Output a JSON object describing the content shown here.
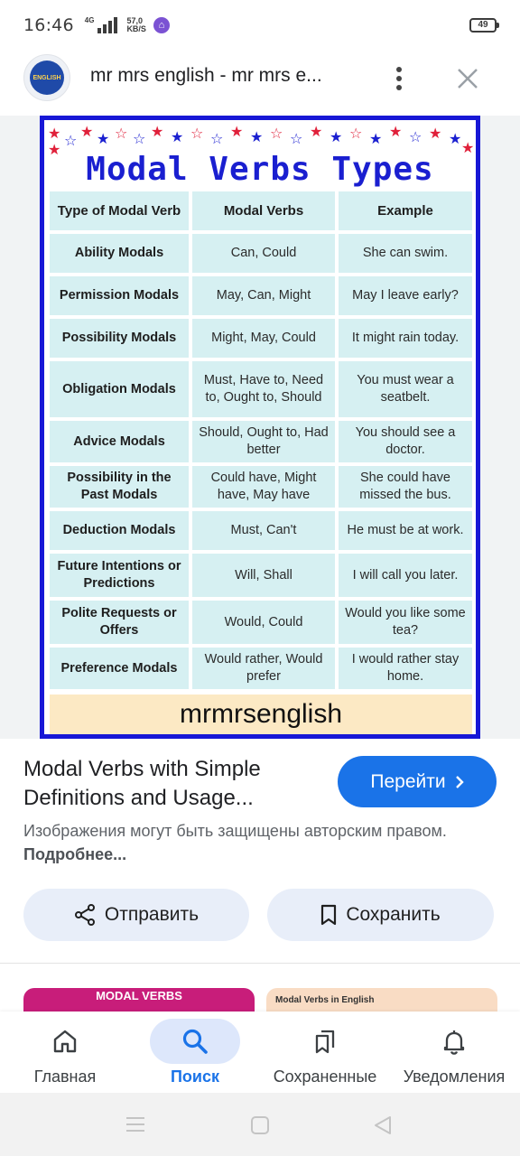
{
  "status_bar": {
    "time": "16:46",
    "network": "4G",
    "speed_value": "57,0",
    "speed_unit": "KB/S",
    "battery": "49"
  },
  "header": {
    "avatar_text": "ENGLISH",
    "title": "mr mrs english - mr mrs e..."
  },
  "infographic": {
    "title": "Modal Verbs Types",
    "headers": [
      "Type of Modal Verb",
      "Modal Verbs",
      "Example"
    ],
    "rows": [
      [
        "Ability Modals",
        "Can, Could",
        "She can swim."
      ],
      [
        "Permission Modals",
        "May, Can, Might",
        "May I leave early?"
      ],
      [
        "Possibility Modals",
        "Might, May, Could",
        "It might rain today."
      ],
      [
        "Obligation Modals",
        "Must, Have to, Need to, Ought to, Should",
        "You must wear a seatbelt."
      ],
      [
        "Advice Modals",
        "Should, Ought to, Had better",
        "You should see a doctor."
      ],
      [
        "Possibility in the Past Modals",
        "Could have, Might have, May have",
        "She could have missed the bus."
      ],
      [
        "Deduction Modals",
        "Must, Can't",
        "He must be at work."
      ],
      [
        "Future Intentions or Predictions",
        "Will, Shall",
        "I will call you later."
      ],
      [
        "Polite Requests or Offers",
        "Would, Could",
        "Would you like some tea?"
      ],
      [
        "Preference Modals",
        "Would rather, Would prefer",
        "I would rather stay home."
      ]
    ],
    "brand": "mrmrsenglish",
    "colors": {
      "border": "#1717d6",
      "title": "#1a1fd0",
      "cell": "#d6f0f2",
      "brand_bg": "#fce9c4"
    }
  },
  "result": {
    "title": "Modal Verbs with Simple Definitions and Usage...",
    "go_button": "Перейти",
    "copyright_text": "Изображения могут быть защищены авторским правом.",
    "copyright_link": "Подробнее..."
  },
  "actions": {
    "share": "Отправить",
    "save": "Сохранить"
  },
  "related": {
    "thumb1_label": "MODAL VERBS",
    "thumb2_label": "Modal Verbs in English"
  },
  "bottom_nav": {
    "home": "Главная",
    "search": "Поиск",
    "saved": "Сохраненные",
    "notifications": "Уведомления"
  },
  "accent_color": "#1a73e8"
}
